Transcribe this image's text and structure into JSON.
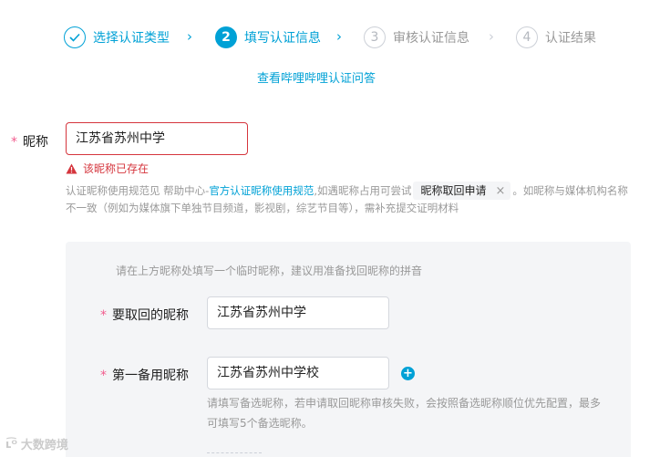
{
  "steps": [
    {
      "num": "✓",
      "label": "选择认证类型",
      "state": "done"
    },
    {
      "num": "2",
      "label": "填写认证信息",
      "state": "active"
    },
    {
      "num": "3",
      "label": "审核认证信息",
      "state": "todo"
    },
    {
      "num": "4",
      "label": "认证结果",
      "state": "todo"
    }
  ],
  "step_separator": "›",
  "faq_link": "查看哔哩哔哩认证问答",
  "required_mark": "*",
  "nickname": {
    "label": "昵称",
    "value": "江苏省苏州中学",
    "error": "该昵称已存在"
  },
  "help": {
    "part1": "认证昵称使用规范见 帮助中心-",
    "link": "官方认证昵称使用规范",
    "part2": ",如遇昵称占用可尝试",
    "tag": "昵称取回申请",
    "tag_close": "×",
    "part3": "。如昵称与媒体机构名称不一致（例如为媒体旗下单独节目频道，影视剧，综艺节目等），需补充提交证明材料"
  },
  "retrieve": {
    "hint": "请在上方昵称处填写一个临时昵称，建议用准备找回昵称的拼音",
    "target_label": "要取回的昵称",
    "target_value": "江苏省苏州中学",
    "backup_label": "第一备用昵称",
    "backup_value": "江苏省苏州中学校",
    "add_icon": "+",
    "backup_help": "请填写备选昵称，若申请取回昵称审核失败，会按照备选昵称顺位优先配置，最多可填写5个备选昵称。"
  },
  "watermark": {
    "logo": "ʟ͡ᴼ",
    "text": "大数跨境"
  },
  "colors": {
    "accent": "#00a1d6",
    "error": "#d5353d",
    "required": "#f25d8e",
    "panel": "#f4f5f7"
  }
}
